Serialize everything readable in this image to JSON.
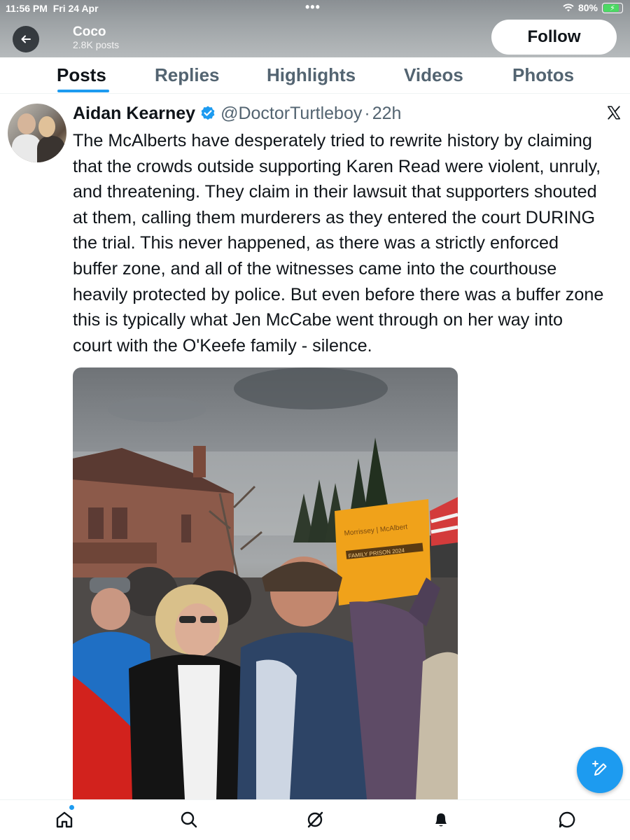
{
  "status_bar": {
    "time": "11:56 PM",
    "date": "Fri 24 Apr",
    "center_dots": "•••",
    "battery_percent": "80%",
    "battery_level": 0.8
  },
  "profile": {
    "name": "Coco",
    "posts": "2.8K posts",
    "follow_label": "Follow"
  },
  "tabs": [
    {
      "label": "Posts",
      "active": true
    },
    {
      "label": "Replies",
      "active": false
    },
    {
      "label": "Highlights",
      "active": false
    },
    {
      "label": "Videos",
      "active": false
    },
    {
      "label": "Photos",
      "active": false
    }
  ],
  "tweet": {
    "author_name": "Aidan Kearney",
    "author_handle": "@DoctorTurtleboy",
    "separator": "·",
    "time_ago": "22h",
    "verified_icon": "verified-badge-icon",
    "text": "The McAlberts have desperately tried to rewrite history by claiming\nthat the crowds outside supporting Karen Read were violent, unruly,\nand threatening. They claim in their lawsuit that supporters shouted\nat them, calling them murderers as they entered the court DURING\nthe trial. This never happened, as there was a strictly enforced\nbuffer zone, and all of the witnesses came into the courthouse\nheavily protected by police. But even before there was a buffer zone\nthis is typically what Jen McCabe went through on her way into\ncourt with the O'Keefe family - silence.",
    "media": {
      "sign_text_top": "Morrissey | McAlbert",
      "sign_text_bottom": "FAMILY PRISON 2024"
    }
  },
  "bottom_nav": {
    "icons": [
      "home-icon",
      "search-icon",
      "grok-icon",
      "notifications-icon",
      "messages-icon"
    ]
  },
  "colors": {
    "accent": "#1d9bf0",
    "text_primary": "#0f1419",
    "text_secondary": "#536471",
    "battery_green": "#4cd964"
  }
}
